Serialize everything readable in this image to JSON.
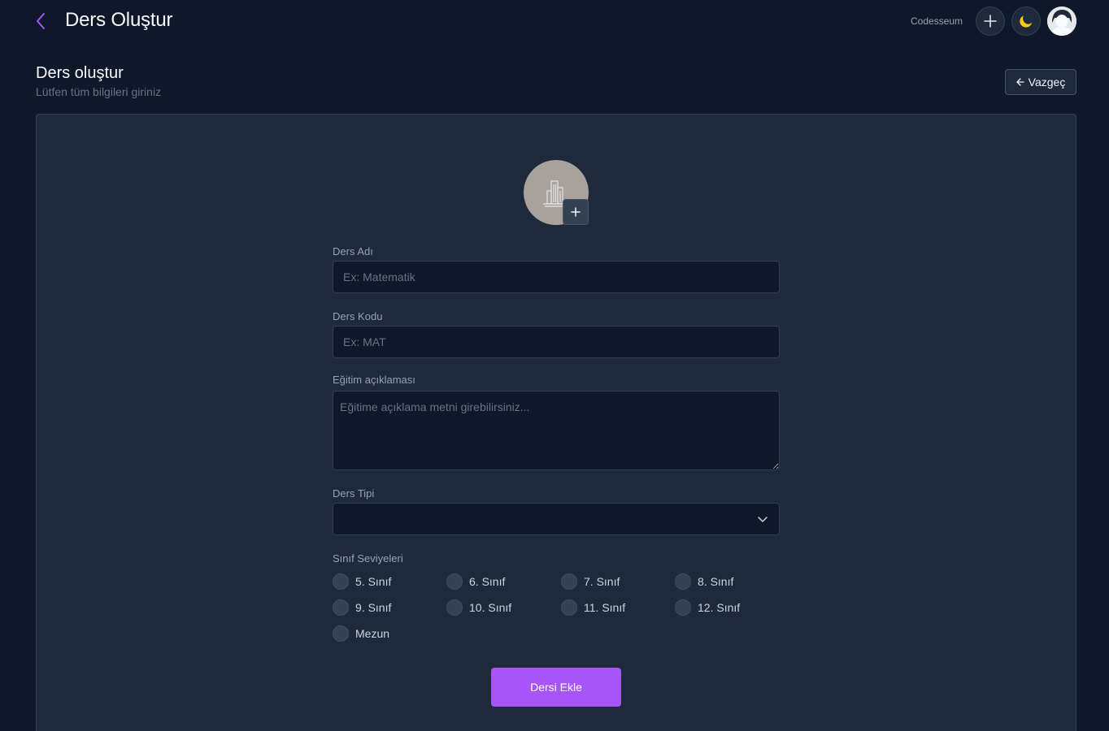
{
  "header": {
    "title": "Ders Oluştur",
    "brand": "Codesseum",
    "back_icon": "chevron-left-icon",
    "accent": "#a855f7",
    "theme_icon_color": "#facc15"
  },
  "page": {
    "title": "Ders oluştur",
    "subtitle": "Lütfen tüm bilgileri giriniz",
    "cancel_label": "Vazgeç"
  },
  "form": {
    "name": {
      "label": "Ders Adı",
      "placeholder": "Ex: Matematik",
      "value": ""
    },
    "code": {
      "label": "Ders Kodu",
      "placeholder": "Ex: MAT",
      "value": ""
    },
    "description": {
      "label": "Eğitim açıklaması",
      "placeholder": "Eğitime açıklama metni girebilirsiniz...",
      "value": ""
    },
    "type": {
      "label": "Ders Tipi",
      "selected": ""
    },
    "levels": {
      "label": "Sınıf Seviyeleri",
      "options": [
        "5. Sınıf",
        "6. Sınıf",
        "7. Sınıf",
        "8. Sınıf",
        "9. Sınıf",
        "10. Sınıf",
        "11. Sınıf",
        "12. Sınıf",
        "Mezun"
      ]
    },
    "submit_label": "Dersi Ekle"
  }
}
